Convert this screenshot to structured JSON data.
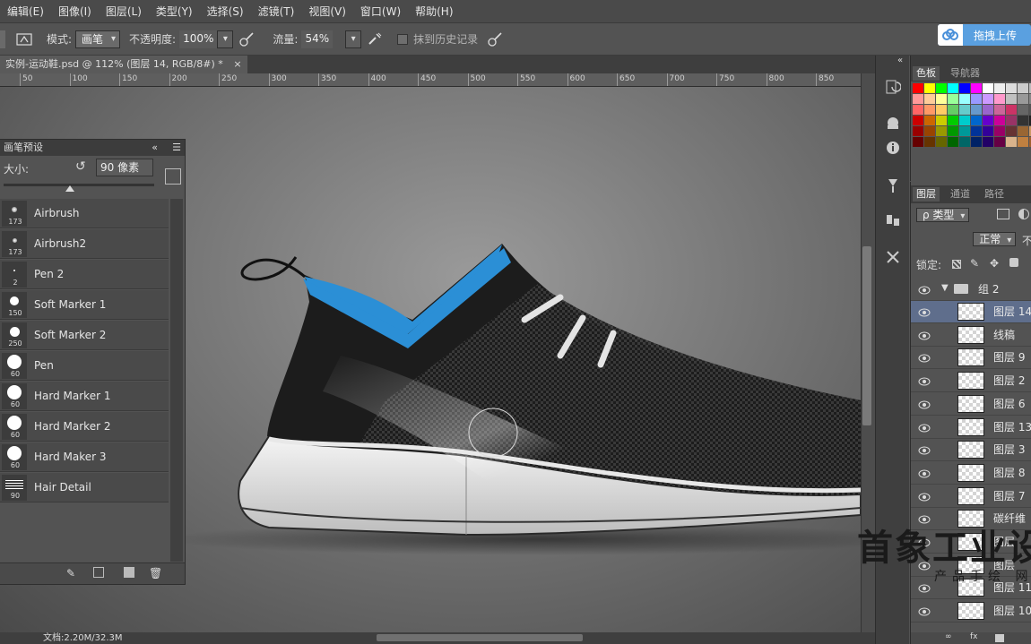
{
  "menubar": {
    "items": [
      "编辑(E)",
      "图像(I)",
      "图层(L)",
      "类型(Y)",
      "选择(S)",
      "滤镜(T)",
      "视图(V)",
      "窗口(W)",
      "帮助(H)"
    ]
  },
  "options": {
    "mode_label": "模式:",
    "mode_value": "画笔",
    "opacity_label": "不透明度:",
    "opacity_value": "100%",
    "flow_label": "流量:",
    "flow_value": "54%",
    "history_label": "抹到历史记录"
  },
  "upload": {
    "label": "拖拽上传"
  },
  "document": {
    "tab_title": "实例-运动鞋.psd @ 112% (图层 14, RGB/8#) *",
    "status": "文档:2.20M/32.3M"
  },
  "ruler": {
    "ticks": [
      "50",
      "100",
      "150",
      "200",
      "250",
      "300",
      "350",
      "400",
      "450",
      "500",
      "550",
      "600",
      "650",
      "700",
      "750",
      "800",
      "850"
    ]
  },
  "brush_panel": {
    "title": "画笔预设",
    "size_label": "大小:",
    "size_value": "90 像素",
    "brushes": [
      {
        "name": "Airbrush",
        "size": "173"
      },
      {
        "name": "Airbrush2",
        "size": "173"
      },
      {
        "name": "Pen 2",
        "size": "2"
      },
      {
        "name": "Soft Marker 1",
        "size": "150"
      },
      {
        "name": "Soft Marker 2",
        "size": "250"
      },
      {
        "name": "Pen",
        "size": "60"
      },
      {
        "name": "Hard Marker 1",
        "size": "60"
      },
      {
        "name": "Hard Marker 2",
        "size": "60"
      },
      {
        "name": "Hard Maker 3",
        "size": "60"
      },
      {
        "name": "Hair Detail",
        "size": "90"
      }
    ]
  },
  "color_panel": {
    "tabs": [
      "色板",
      "导航器"
    ]
  },
  "colors": {
    "accent_blue": "#2b8fd6",
    "swatches": [
      "#ff0000",
      "#ffff00",
      "#00ff00",
      "#00ffff",
      "#0000ff",
      "#ff00ff",
      "#ffffff",
      "#eeeeee",
      "#dddddd",
      "#cccccc",
      "#bbbbbb",
      "#aaaaaa",
      "#ff9999",
      "#ffcc99",
      "#ffff99",
      "#99ff99",
      "#99ffff",
      "#9999ff",
      "#cc99ff",
      "#ff99cc",
      "#c0c0c0",
      "#999999",
      "#888888",
      "#777777",
      "#ff6666",
      "#ff9966",
      "#ffcc66",
      "#66cc66",
      "#66cccc",
      "#6699cc",
      "#9966cc",
      "#cc6699",
      "#cc3366",
      "#666666",
      "#555555",
      "#444444",
      "#cc0000",
      "#cc6600",
      "#cccc00",
      "#00cc00",
      "#00cccc",
      "#0066cc",
      "#6600cc",
      "#cc0099",
      "#993366",
      "#333333",
      "#222222",
      "#111111",
      "#990000",
      "#994400",
      "#999900",
      "#009900",
      "#009999",
      "#003399",
      "#330099",
      "#990066",
      "#663333",
      "#996633",
      "#cc9966",
      "#663300",
      "#660000",
      "#663300",
      "#666600",
      "#006600",
      "#006666",
      "#002266",
      "#220066",
      "#660044",
      "#d9b38c",
      "#c08040",
      "#a06030",
      "#805020"
    ]
  },
  "layers_panel": {
    "tabs": [
      "图层",
      "通道",
      "路径"
    ],
    "filter_label": "ρ 类型",
    "blend_mode": "正常",
    "opacity_short": "不",
    "lock_label": "锁定:",
    "group_name": "组 2",
    "layers": [
      "图层 14",
      "线稿",
      "图层 9",
      "图层 2",
      "图层 6",
      "图层 13",
      "图层 3",
      "图层 8",
      "图层 7",
      "碳纤维",
      "图层",
      "图层",
      "图层 11",
      "图层 10"
    ]
  },
  "watermark": {
    "line1": "首象工业设",
    "line2": "产品手绘 网"
  }
}
